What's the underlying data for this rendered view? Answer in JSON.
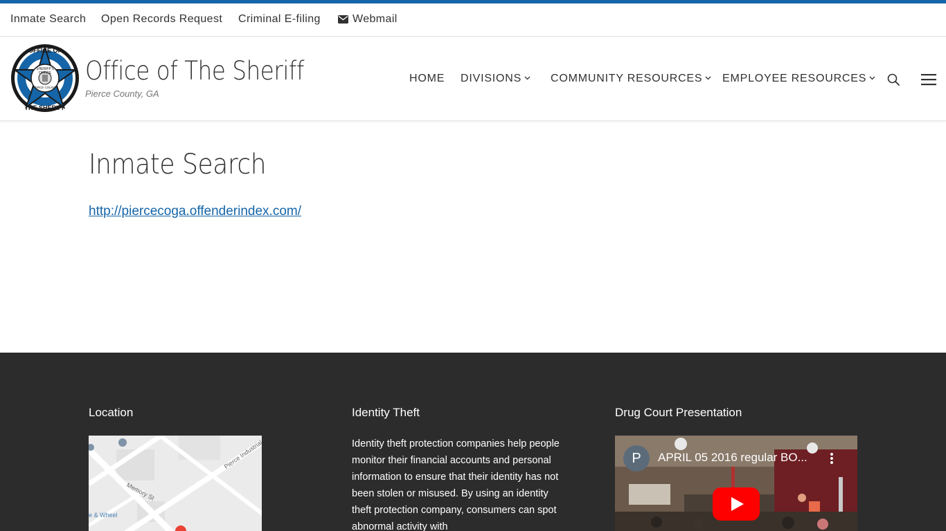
{
  "topbar": {
    "links": [
      {
        "label": "Inmate Search"
      },
      {
        "label": "Open Records Request"
      },
      {
        "label": "Criminal E-filing"
      },
      {
        "label": "Webmail",
        "icon": "envelope-icon"
      }
    ]
  },
  "header": {
    "site_title": "Office of The Sheriff",
    "tagline": "Pierce County, GA",
    "logo_text": {
      "top": "OFFICE OF",
      "bottom": "THE SHERIFF",
      "inner_top": "SHERIFF'S",
      "inner_mid": "OFFICE",
      "inner_bottom": "PIERCE COUNTY"
    },
    "nav": [
      {
        "label": "HOME",
        "has_dropdown": false
      },
      {
        "label": "DIVISIONS",
        "has_dropdown": true
      },
      {
        "label": "COMMUNITY RESOURCES",
        "has_dropdown": true
      },
      {
        "label": "EMPLOYEE RESOURCES",
        "has_dropdown": true
      }
    ],
    "icons": [
      "search-icon",
      "hamburger-menu-icon"
    ]
  },
  "main": {
    "title": "Inmate Search",
    "link": "http://piercecoga.offenderindex.com/"
  },
  "footer": {
    "location": {
      "title": "Location",
      "map_labels": [
        "Memory St",
        "Pierce Industrial B",
        "e & Wheel"
      ]
    },
    "identity_theft": {
      "title": "Identity Theft",
      "text": "Identity theft protection companies help people monitor their financial accounts and personal information to ensure that their identity has not been stolen or misused. By using an identity theft protection company, consumers can spot abnormal activity with"
    },
    "drug_court": {
      "title": "Drug Court Presentation",
      "video_title": "APRIL 05 2016 regular BO...",
      "channel_initial": "P"
    }
  },
  "colors": {
    "accent": "#1565a8",
    "text": "#313131",
    "footer_bg": "#2c2c2c",
    "youtube_red": "#ff0000"
  }
}
